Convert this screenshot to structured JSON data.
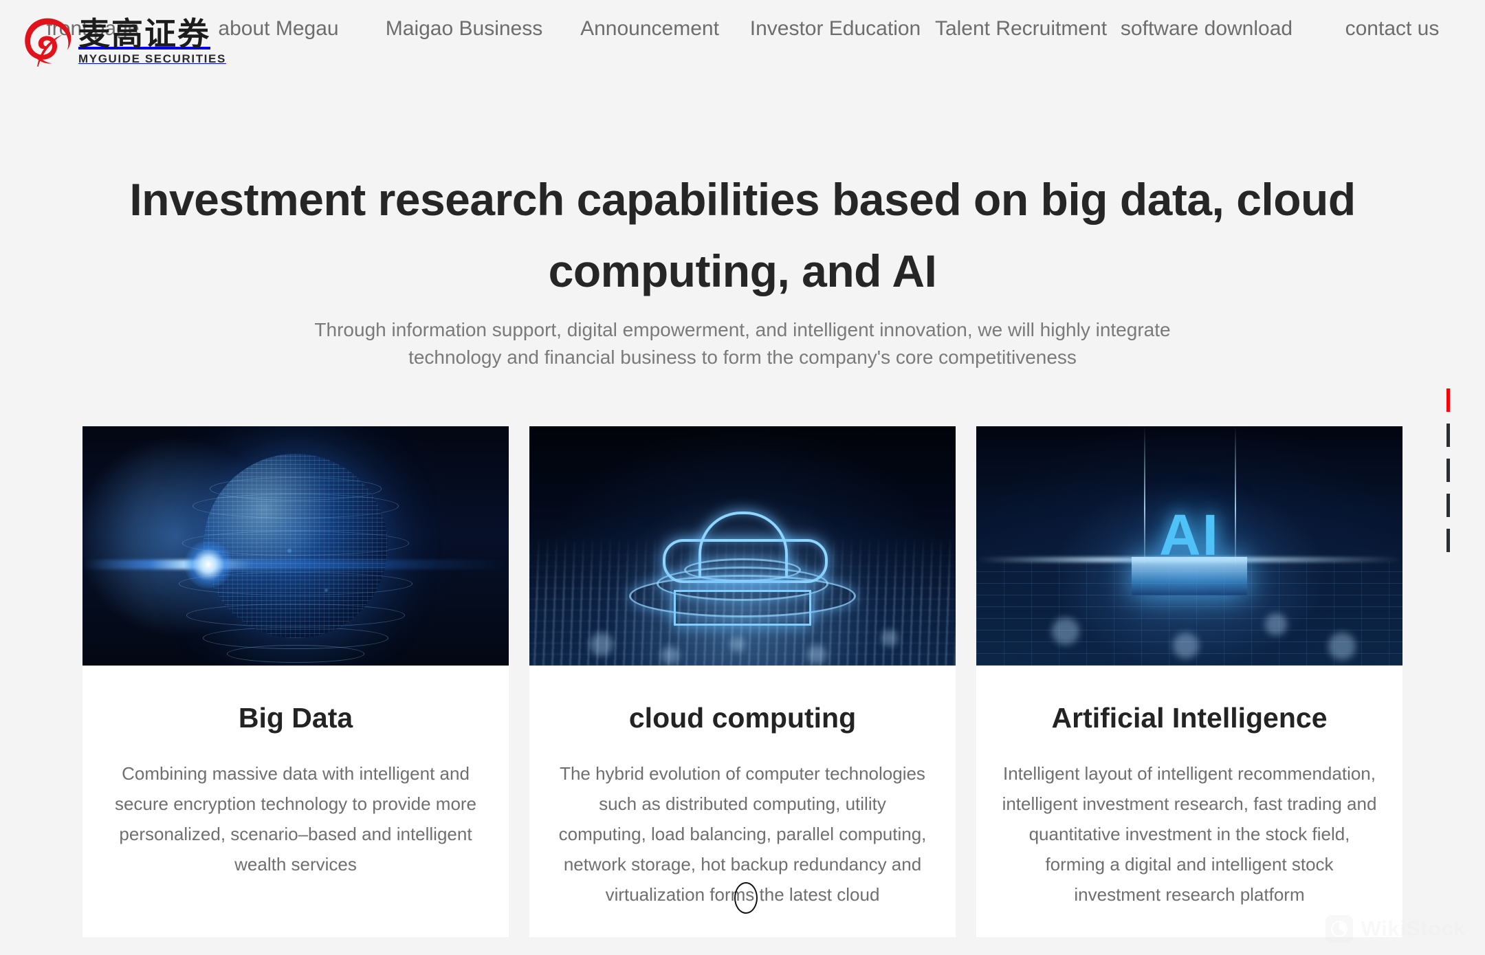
{
  "brand": {
    "logo_icon": "maigao-spiral-logo-icon",
    "name_cn": "麦高证券",
    "name_en": "MYGUIDE SECURITIES",
    "accent_color": "#e1121a"
  },
  "nav": {
    "items": [
      {
        "label": "front page",
        "icon": "home-icon"
      },
      {
        "label": "about Megau",
        "icon": "info-icon"
      },
      {
        "label": "Maigao Business",
        "icon": "briefcase-icon"
      },
      {
        "label": "Announcement",
        "icon": "megaphone-icon"
      },
      {
        "label": "Investor Education",
        "icon": "book-icon"
      },
      {
        "label": "Talent Recruitment",
        "icon": "users-icon"
      },
      {
        "label": "software download",
        "icon": "download-icon"
      },
      {
        "label": "contact us",
        "icon": "mail-icon"
      }
    ]
  },
  "hero": {
    "title": "Investment research capabilities based on big data, cloud computing, and AI",
    "subtitle": "Through information support, digital empowerment, and intelligent innovation, we will highly integrate technology and financial business to form the company's core competitiveness"
  },
  "cards": [
    {
      "image_alt": "digital-globe-image",
      "title": "Big Data",
      "text": "Combining massive data with intelligent and secure encryption technology to provide more personalized, scenario–based and intelligent wealth services"
    },
    {
      "image_alt": "glowing-cloud-circuit-image",
      "title": "cloud computing",
      "text": "The hybrid evolution of computer technologies such as distributed computing, utility computing, load balancing, parallel computing, network storage, hot backup redundancy and virtualization forms the latest cloud"
    },
    {
      "image_alt": "ai-pedestal-image",
      "title": "Artificial Intelligence",
      "text": "Intelligent layout of intelligent recommendation, intelligent investment research, fast trading and quantitative investment in the stock field, forming a digital and intelligent stock investment research platform"
    }
  ],
  "section_nav": {
    "active_index": 0,
    "count": 5,
    "active_color": "#fb0007",
    "inactive_color": "#2b2f33"
  },
  "watermark": {
    "label": "WikiStock",
    "icon": "wikistock-logo-icon"
  },
  "cursor": {
    "icon": "text-cursor-ellipse-icon"
  },
  "artwork": {
    "ai_label": "AI"
  }
}
